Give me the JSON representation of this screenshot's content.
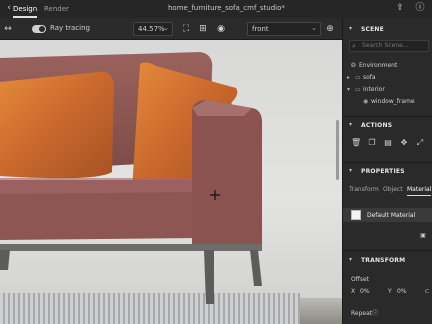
{
  "tabs": [
    {
      "label": "Design"
    },
    {
      "label": "Render"
    }
  ],
  "doc_title": "home_furniture_sofa_cmf_studio*",
  "toolbar": {
    "ray_tracing_label": "Ray tracing",
    "zoom_value": "44.57%",
    "camera_view": "front"
  },
  "scene": {
    "header": "SCENE",
    "search_placeholder": "Search Scene...",
    "items": [
      {
        "label": "Environment"
      },
      {
        "label": "sofa"
      },
      {
        "label": "interior"
      },
      {
        "label": "window_frame"
      }
    ]
  },
  "actions": {
    "header": "ACTIONS"
  },
  "properties": {
    "header": "PROPERTIES",
    "tabs": [
      {
        "label": "Transform"
      },
      {
        "label": "Object"
      },
      {
        "label": "Material"
      }
    ],
    "material_name": "Default Material"
  },
  "transform": {
    "header": "TRANSFORM",
    "offset_label": "Offset",
    "x_label": "X",
    "x_value": "0%",
    "y_label": "Y",
    "y_value": "0%",
    "repeat_label": "Repeat"
  },
  "colors": {
    "accent": "#e0e0e0",
    "panel_bg": "#2a2a2a",
    "sofa_leather": "#8a5450",
    "pillow": "#c9702e"
  }
}
